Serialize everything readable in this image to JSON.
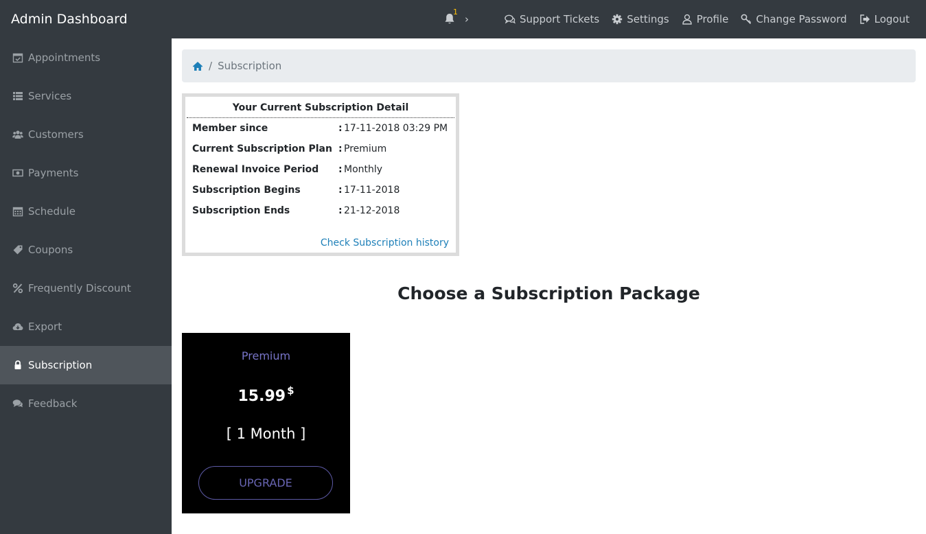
{
  "app": {
    "title": "Admin Dashboard"
  },
  "topnav": {
    "notification_count": "1",
    "chevron": "›",
    "links": [
      {
        "label": "Support Tickets",
        "icon": "comments-icon"
      },
      {
        "label": "Settings",
        "icon": "gear-icon"
      },
      {
        "label": "Profile",
        "icon": "user-icon"
      },
      {
        "label": "Change Password",
        "icon": "key-icon"
      },
      {
        "label": "Logout",
        "icon": "sign-out-icon"
      }
    ]
  },
  "sidebar": {
    "items": [
      {
        "label": "Appointments",
        "icon": "calendar-check-icon",
        "active": false
      },
      {
        "label": "Services",
        "icon": "list-icon",
        "active": false
      },
      {
        "label": "Customers",
        "icon": "users-icon",
        "active": false
      },
      {
        "label": "Payments",
        "icon": "money-icon",
        "active": false
      },
      {
        "label": "Schedule",
        "icon": "calendar-icon",
        "active": false
      },
      {
        "label": "Coupons",
        "icon": "tags-icon",
        "active": false
      },
      {
        "label": "Frequently Discount",
        "icon": "percent-icon",
        "active": false
      },
      {
        "label": "Export",
        "icon": "cloud-download-icon",
        "active": false
      },
      {
        "label": "Subscription",
        "icon": "lock-icon",
        "active": true
      },
      {
        "label": "Feedback",
        "icon": "comments-icon",
        "active": false
      }
    ]
  },
  "breadcrumb": {
    "separator": "/",
    "current": "Subscription"
  },
  "subscription_detail": {
    "title": "Your Current Subscription Detail",
    "rows": [
      {
        "label": "Member since",
        "value": "17-11-2018 03:29 PM"
      },
      {
        "label": "Current Subscription Plan",
        "value": "Premium"
      },
      {
        "label": "Renewal Invoice Period",
        "value": "Monthly"
      },
      {
        "label": "Subscription Begins",
        "value": "17-11-2018"
      },
      {
        "label": "Subscription Ends",
        "value": "21-12-2018"
      }
    ],
    "colon": ":",
    "history_link": "Check Subscription history"
  },
  "packages": {
    "heading": "Choose a Subscription Package",
    "items": [
      {
        "name": "Premium",
        "price": "15.99",
        "currency": "$",
        "term": "[ 1 Month ]",
        "button": "UPGRADE"
      }
    ]
  },
  "colors": {
    "nav_bg": "#343a40",
    "active_bg": "#4f555b",
    "link": "#1d7fb8",
    "package_accent": "#7774c7"
  }
}
